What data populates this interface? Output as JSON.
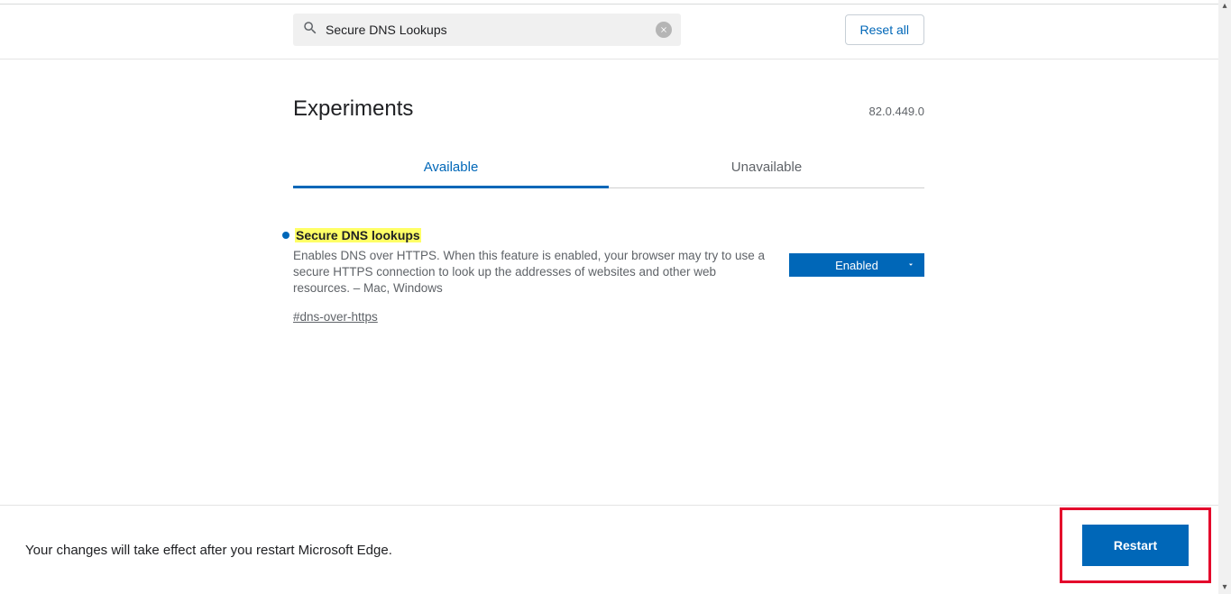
{
  "search": {
    "value": "Secure DNS Lookups"
  },
  "header": {
    "reset_label": "Reset all",
    "title": "Experiments",
    "version": "82.0.449.0"
  },
  "tabs": {
    "available": "Available",
    "unavailable": "Unavailable"
  },
  "flag": {
    "title": "Secure DNS lookups",
    "description": "Enables DNS over HTTPS. When this feature is enabled, your browser may try to use a secure HTTPS connection to look up the addresses of websites and other web resources. – Mac, Windows",
    "hash": "#dns-over-https",
    "state": "Enabled"
  },
  "footer": {
    "message": "Your changes will take effect after you restart Microsoft Edge.",
    "restart_label": "Restart"
  }
}
